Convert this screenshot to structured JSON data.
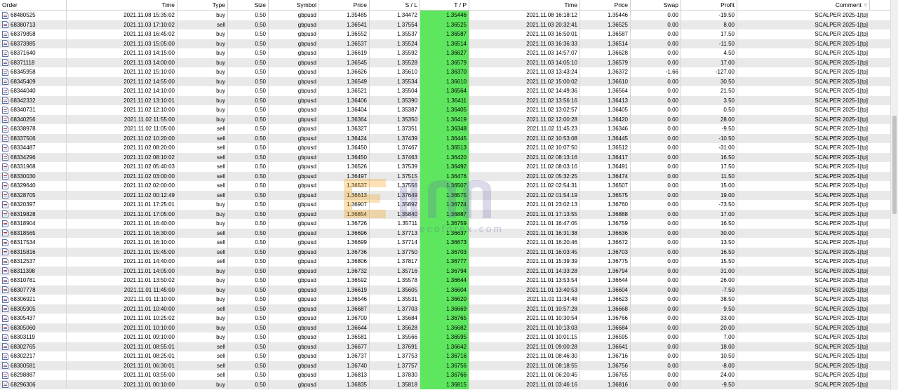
{
  "headers": {
    "order": "Order",
    "time": "Time",
    "type": "Type",
    "size": "Size",
    "symbol": "Symbol",
    "price": "Price",
    "sl": "S / L",
    "tp": "T / P",
    "close_time": "Time",
    "close_price": "Price",
    "swap": "Swap",
    "profit": "Profit",
    "comment": "Comment"
  },
  "sort_icon": "sort-descending-icon",
  "row_icon": "document-icon",
  "watermark_text": "ecoforex.com",
  "accent_tp_color": "#5ee65e",
  "rows": [
    [
      "68480525",
      "2021.11.08 15:35:02",
      "buy",
      "0.50",
      "gbpusd",
      "1.35485",
      "1.34472",
      "1.35446",
      "2021.11.08 16:18:12",
      "1.35446",
      "0.00",
      "-19.50",
      "SCALPER 2025-1[tp]"
    ],
    [
      "68380713",
      "2021.11.03 17:10:02",
      "sell",
      "0.50",
      "gbpusd",
      "1.36541",
      "1.37554",
      "1.36525",
      "2021.11.03 20:32:41",
      "1.36525",
      "0.00",
      "8.00",
      "SCALPER 2025-1[tp]"
    ],
    [
      "68379858",
      "2021.11.03 16:45:02",
      "buy",
      "0.50",
      "gbpusd",
      "1.36552",
      "1.35537",
      "1.36587",
      "2021.11.03 16:50:01",
      "1.36587",
      "0.00",
      "17.50",
      "SCALPER 2025-1[tp]"
    ],
    [
      "68373985",
      "2021.11.03 15:05:00",
      "buy",
      "0.50",
      "gbpusd",
      "1.36537",
      "1.35524",
      "1.36514",
      "2021.11.03 16:36:33",
      "1.36514",
      "0.00",
      "-11.50",
      "SCALPER 2025-1[tp]"
    ],
    [
      "68371640",
      "2021.11.03 14:15:00",
      "buy",
      "0.50",
      "gbpusd",
      "1.36619",
      "1.35592",
      "1.36627",
      "2021.11.03 14:57:07",
      "1.36628",
      "0.00",
      "4.50",
      "SCALPER 2025-1[tp]"
    ],
    [
      "68371118",
      "2021.11.03 14:00:00",
      "buy",
      "0.50",
      "gbpusd",
      "1.36545",
      "1.35528",
      "1.36579",
      "2021.11.03 14:05:10",
      "1.36579",
      "0.00",
      "17.00",
      "SCALPER 2025-1[tp]"
    ],
    [
      "68345958",
      "2021.11.02 15:10:00",
      "buy",
      "0.50",
      "gbpusd",
      "1.36626",
      "1.35610",
      "1.36370",
      "2021.11.03 13:43:24",
      "1.36372",
      "-1.66",
      "-127.00",
      "SCALPER 2025-1[tp]"
    ],
    [
      "68345409",
      "2021.11.02 14:55:00",
      "buy",
      "0.50",
      "gbpusd",
      "1.36549",
      "1.35534",
      "1.36610",
      "2021.11.02 15:00:02",
      "1.36610",
      "0.00",
      "30.50",
      "SCALPER 2025-1[tp]"
    ],
    [
      "68344040",
      "2021.11.02 14:10:00",
      "buy",
      "0.50",
      "gbpusd",
      "1.36521",
      "1.35504",
      "1.36564",
      "2021.11.02 14:49:36",
      "1.36564",
      "0.00",
      "21.50",
      "SCALPER 2025-1[tp]"
    ],
    [
      "68342332",
      "2021.11.02 13:10:01",
      "buy",
      "0.50",
      "gbpusd",
      "1.36406",
      "1.35390",
      "1.36411",
      "2021.11.02 13:56:16",
      "1.36413",
      "0.00",
      "3.50",
      "SCALPER 2025-1[tp]"
    ],
    [
      "68340731",
      "2021.11.02 12:10:00",
      "buy",
      "0.50",
      "gbpusd",
      "1.36404",
      "1.35387",
      "1.36405",
      "2021.11.02 13:02:57",
      "1.36405",
      "0.00",
      "0.50",
      "SCALPER 2025-1[tp]"
    ],
    [
      "68340256",
      "2021.11.02 11:55:00",
      "buy",
      "0.50",
      "gbpusd",
      "1.36364",
      "1.35350",
      "1.36419",
      "2021.11.02 12:00:28",
      "1.36420",
      "0.00",
      "28.00",
      "SCALPER 2025-1[tp]"
    ],
    [
      "68338978",
      "2021.11.02 11:05:00",
      "sell",
      "0.50",
      "gbpusd",
      "1.36327",
      "1.37351",
      "1.36348",
      "2021.11.02 11:45:23",
      "1.36346",
      "0.00",
      "-9.50",
      "SCALPER 2025-1[tp]"
    ],
    [
      "68337506",
      "2021.11.02 10:20:00",
      "sell",
      "0.50",
      "gbpusd",
      "1.36424",
      "1.37439",
      "1.36445",
      "2021.11.02 10:53:08",
      "1.36445",
      "0.00",
      "-10.50",
      "SCALPER 2025-1[tp]"
    ],
    [
      "68334487",
      "2021.11.02 08:20:00",
      "sell",
      "0.50",
      "gbpusd",
      "1.36450",
      "1.37467",
      "1.36513",
      "2021.11.02 10:07:50",
      "1.36512",
      "0.00",
      "-31.00",
      "SCALPER 2025-1[tp]"
    ],
    [
      "68334296",
      "2021.11.02 08:10:02",
      "sell",
      "0.50",
      "gbpusd",
      "1.36450",
      "1.37463",
      "1.36420",
      "2021.11.02 08:13:16",
      "1.36417",
      "0.00",
      "16.50",
      "SCALPER 2025-1[tp]"
    ],
    [
      "68331968",
      "2021.11.02 05:40:03",
      "sell",
      "0.50",
      "gbpusd",
      "1.36526",
      "1.37539",
      "1.36492",
      "2021.11.02 08:03:16",
      "1.36491",
      "0.00",
      "17.50",
      "SCALPER 2025-1[tp]"
    ],
    [
      "68330030",
      "2021.11.02 03:00:00",
      "sell",
      "0.50",
      "gbpusd",
      "1.36497",
      "1.37515",
      "1.36476",
      "2021.11.02 05:32:25",
      "1.36474",
      "0.00",
      "11.50",
      "SCALPER 2025-1[tp]"
    ],
    [
      "68329640",
      "2021.11.02 02:00:00",
      "sell",
      "0.50",
      "gbpusd",
      "1.36537",
      "1.37556",
      "1.36507",
      "2021.11.02 02:54:31",
      "1.36507",
      "0.00",
      "15.00",
      "SCALPER 2025-1[tp]"
    ],
    [
      "68328705",
      "2021.11.02 00:12:49",
      "sell",
      "0.50",
      "gbpusd",
      "1.36613",
      "1.37649",
      "1.36575",
      "2021.11.02 01:54:19",
      "1.36575",
      "0.00",
      "19.00",
      "SCALPER 2025-1[tp]"
    ],
    [
      "68320397",
      "2021.11.01 17:25:01",
      "buy",
      "0.50",
      "gbpusd",
      "1.36907",
      "1.35892",
      "1.36724",
      "2021.11.01 23:02:13",
      "1.36760",
      "0.00",
      "-73.50",
      "SCALPER 2025-1[tp]"
    ],
    [
      "68319828",
      "2021.11.01 17:05:00",
      "buy",
      "0.50",
      "gbpusd",
      "1.36854",
      "1.35840",
      "1.36887",
      "2021.11.01 17:13:55",
      "1.36888",
      "0.00",
      "17.00",
      "SCALPER 2025-1[tp]"
    ],
    [
      "68318904",
      "2021.11.01 16:40:00",
      "buy",
      "0.50",
      "gbpusd",
      "1.36726",
      "1.35711",
      "1.36759",
      "2021.11.01 16:47:05",
      "1.36759",
      "0.00",
      "16.50",
      "SCALPER 2025-1[tp]"
    ],
    [
      "68318565",
      "2021.11.01 16:30:00",
      "sell",
      "0.50",
      "gbpusd",
      "1.36696",
      "1.37713",
      "1.36637",
      "2021.11.01 16:31:38",
      "1.36636",
      "0.00",
      "30.00",
      "SCALPER 2025-1[tp]"
    ],
    [
      "68317534",
      "2021.11.01 16:10:00",
      "sell",
      "0.50",
      "gbpusd",
      "1.36699",
      "1.37714",
      "1.36673",
      "2021.11.01 16:20:46",
      "1.36672",
      "0.00",
      "13.50",
      "SCALPER 2025-1[tp]"
    ],
    [
      "68315816",
      "2021.11.01 15:45:00",
      "sell",
      "0.50",
      "gbpusd",
      "1.36736",
      "1.37750",
      "1.36703",
      "2021.11.01 16:03:45",
      "1.36703",
      "0.00",
      "16.50",
      "SCALPER 2025-1[tp]"
    ],
    [
      "68312537",
      "2021.11.01 14:40:00",
      "sell",
      "0.50",
      "gbpusd",
      "1.36806",
      "1.37817",
      "1.36777",
      "2021.11.01 15:39:39",
      "1.36775",
      "0.00",
      "15.50",
      "SCALPER 2025-1[tp]"
    ],
    [
      "68311398",
      "2021.11.01 14:05:00",
      "buy",
      "0.50",
      "gbpusd",
      "1.36732",
      "1.35716",
      "1.36794",
      "2021.11.01 14:33:28",
      "1.36794",
      "0.00",
      "31.00",
      "SCALPER 2025-1[tp]"
    ],
    [
      "68310781",
      "2021.11.01 13:50:02",
      "buy",
      "0.50",
      "gbpusd",
      "1.36592",
      "1.35578",
      "1.36644",
      "2021.11.01 13:53:54",
      "1.36644",
      "0.00",
      "26.00",
      "SCALPER 2025-1[tp]"
    ],
    [
      "68307778",
      "2021.11.01 11:45:00",
      "buy",
      "0.50",
      "gbpusd",
      "1.36619",
      "1.35605",
      "1.36604",
      "2021.11.01 13:40:53",
      "1.36604",
      "0.00",
      "-7.50",
      "SCALPER 2025-1[tp]"
    ],
    [
      "68306921",
      "2021.11.01 11:10:00",
      "buy",
      "0.50",
      "gbpusd",
      "1.36546",
      "1.35531",
      "1.36620",
      "2021.11.01 11:34:48",
      "1.36623",
      "0.00",
      "38.50",
      "SCALPER 2025-1[tp]"
    ],
    [
      "68305905",
      "2021.11.01 10:40:00",
      "sell",
      "0.50",
      "gbpusd",
      "1.36687",
      "1.37703",
      "1.36669",
      "2021.11.01 10:57:28",
      "1.36668",
      "0.00",
      "9.50",
      "SCALPER 2025-1[tp]"
    ],
    [
      "68305437",
      "2021.11.01 10:25:02",
      "buy",
      "0.50",
      "gbpusd",
      "1.36700",
      "1.35684",
      "1.36765",
      "2021.11.01 10:30:54",
      "1.36766",
      "0.00",
      "33.00",
      "SCALPER 2025-1[tp]"
    ],
    [
      "68305060",
      "2021.11.01 10:10:00",
      "buy",
      "0.50",
      "gbpusd",
      "1.36644",
      "1.35628",
      "1.36682",
      "2021.11.01 10:13:03",
      "1.36684",
      "0.00",
      "20.00",
      "SCALPER 2025-1[tp]"
    ],
    [
      "68303119",
      "2021.11.01 09:10:00",
      "buy",
      "0.50",
      "gbpusd",
      "1.36581",
      "1.35566",
      "1.36595",
      "2021.11.01 10:01:15",
      "1.36595",
      "0.00",
      "7.00",
      "SCALPER 2025-1[tp]"
    ],
    [
      "68302765",
      "2021.11.01 08:55:01",
      "sell",
      "0.50",
      "gbpusd",
      "1.36677",
      "1.37691",
      "1.36642",
      "2021.11.01 09:00:28",
      "1.36641",
      "0.00",
      "18.00",
      "SCALPER 2025-1[tp]"
    ],
    [
      "68302217",
      "2021.11.01 08:25:01",
      "sell",
      "0.50",
      "gbpusd",
      "1.36737",
      "1.37753",
      "1.36716",
      "2021.11.01 08:46:30",
      "1.36716",
      "0.00",
      "10.50",
      "SCALPER 2025-1[tp]"
    ],
    [
      "68300581",
      "2021.11.01 06:30:01",
      "sell",
      "0.50",
      "gbpusd",
      "1.36740",
      "1.37757",
      "1.36756",
      "2021.11.01 08:18:55",
      "1.36756",
      "0.00",
      "-8.00",
      "SCALPER 2025-1[tp]"
    ],
    [
      "68298887",
      "2021.11.01 03:55:00",
      "sell",
      "0.50",
      "gbpusd",
      "1.36813",
      "1.37830",
      "1.36766",
      "2021.11.01 06:20:45",
      "1.36765",
      "0.00",
      "24.00",
      "SCALPER 2025-1[tp]"
    ],
    [
      "68296306",
      "2021.11.01 00:10:00",
      "buy",
      "0.50",
      "gbpusd",
      "1.36835",
      "1.35818",
      "1.36815",
      "2021.11.01 03:46:16",
      "1.36816",
      "0.00",
      "-9.50",
      "SCALPER 2025-1[tp]"
    ]
  ]
}
